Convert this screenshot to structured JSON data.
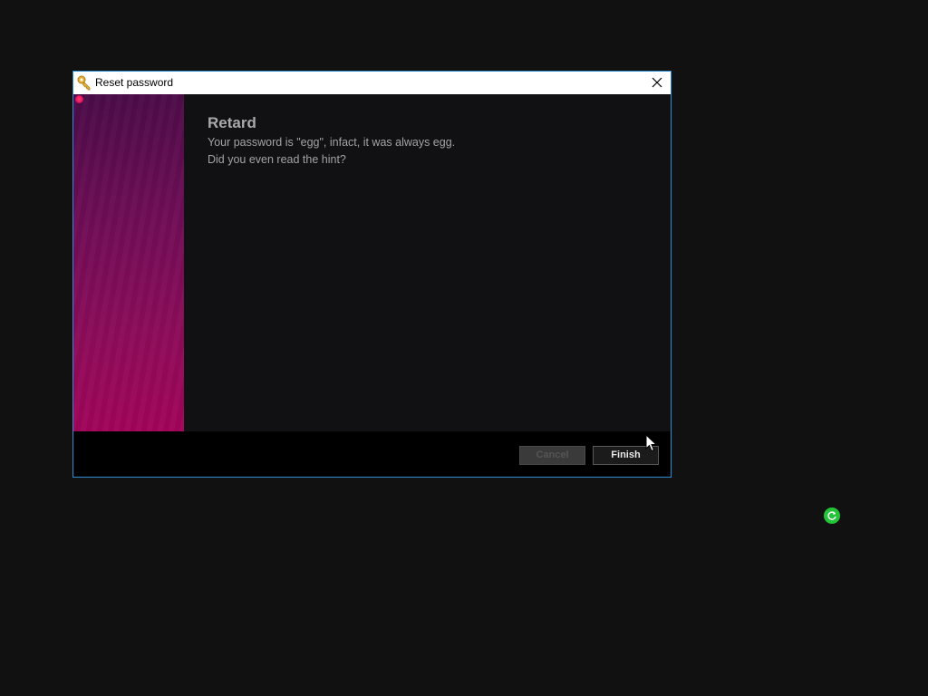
{
  "window": {
    "title": "Reset password",
    "close_glyph": "✕"
  },
  "content": {
    "heading": "Retard",
    "message_lines": [
      "Your password is \"egg\", infact, it was always egg.",
      "Did you even read the hint?"
    ]
  },
  "buttons": {
    "cancel_label": "Cancel",
    "cancel_enabled": false,
    "finish_label": "Finish",
    "finish_enabled": true
  },
  "icons": {
    "title_icon": "key-icon",
    "close_icon": "close-icon",
    "tray_icon": "refresh-icon",
    "cursor": "mouse-pointer-icon"
  },
  "colors": {
    "accent_border": "#2c8fd6",
    "banner_top": "#4a0c47",
    "banner_bottom": "#a3045a",
    "tray_green": "#23c437"
  }
}
